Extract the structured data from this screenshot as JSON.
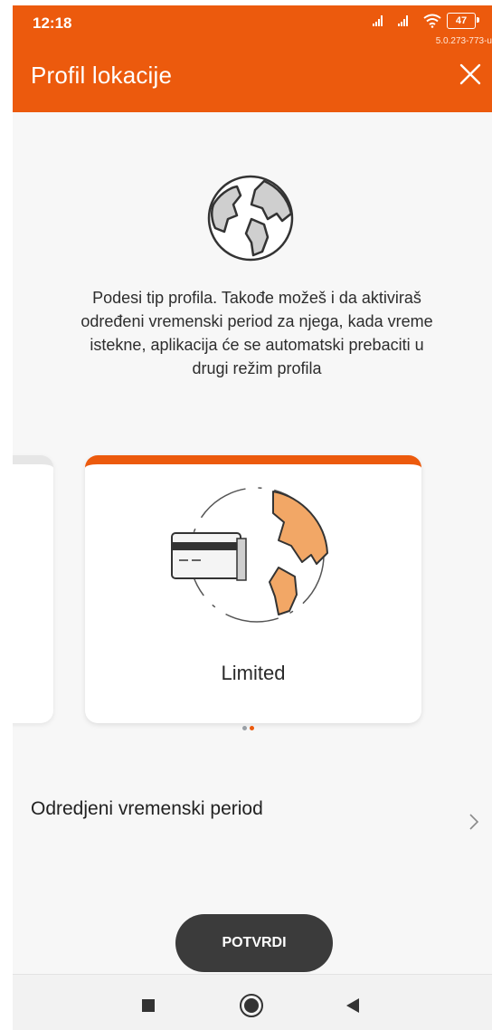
{
  "status_bar": {
    "time": "12:18",
    "battery": "47",
    "version": "5.0.273-773-u"
  },
  "header": {
    "title": "Profil lokacije"
  },
  "intro_text": "Podesi tip profila. Takođe možeš i da aktiviraš određeni vremenski period za njega, kada vreme istekne, aplikacija će se automatski prebaciti u drugi režim profila",
  "card": {
    "label": "Limited"
  },
  "pager": {
    "count": 2,
    "active_index": 1
  },
  "period_row": {
    "label": "Odredjeni vremenski period"
  },
  "confirm_button": {
    "label": "POTVRDI"
  },
  "colors": {
    "accent": "#ec5a0d",
    "card_land": "#f2a766",
    "button": "#3b3b3b"
  }
}
